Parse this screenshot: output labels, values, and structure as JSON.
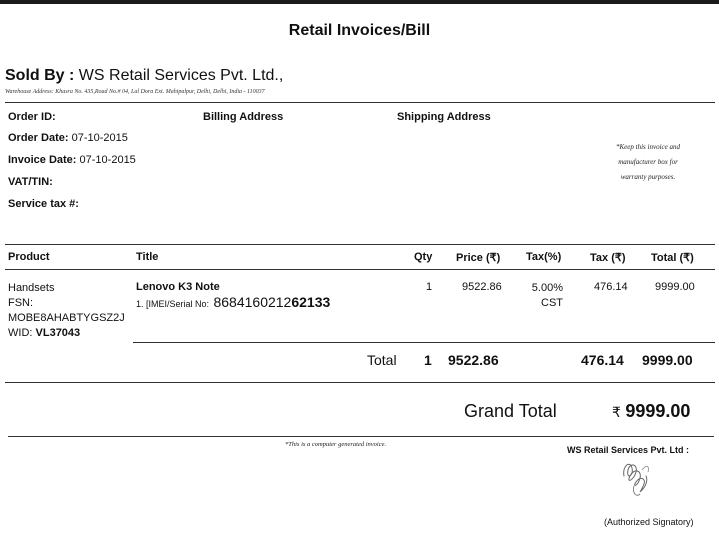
{
  "title": "Retail Invoices/Bill",
  "seller": {
    "sold_by_label": "Sold By :",
    "name": "WS Retail Services Pvt. Ltd.,",
    "warehouse_address": "Warehouse Address: Khasra No. 435,Road No.# 04, Lal Dora Ext. Mahipalpur, Delhi, Delhi, India - 110037"
  },
  "order": {
    "order_id_label": "Order ID:",
    "order_id": "",
    "order_date_label": "Order Date:",
    "order_date": "07-10-2015",
    "invoice_date_label": "Invoice Date:",
    "invoice_date": "07-10-2015",
    "vat_label": "VAT/TIN:",
    "vat": "",
    "service_tax_label": "Service tax #:",
    "service_tax": ""
  },
  "addresses": {
    "billing_label": "Billing Address",
    "shipping_label": "Shipping Address"
  },
  "warranty_note": {
    "line1": "*Keep this invoice and",
    "line2": "manufacturer box for",
    "line3": "warranty purposes."
  },
  "table": {
    "headers": {
      "product": "Product",
      "title": "Title",
      "qty": "Qty",
      "price": "Price (₹)",
      "tax_pct": "Tax(%)",
      "tax": "Tax (₹)",
      "total": "Total (₹)"
    },
    "rows": [
      {
        "product_line1": "Handsets",
        "product_line2": "FSN:",
        "product_line3": "MOBE8AHABTYGSZ2J",
        "wid_label": "WID:",
        "wid": "VL37043",
        "title": "Lenovo K3 Note",
        "imei_label": "1. [IMEI/Serial No:",
        "imei_prefix": "8684160212",
        "imei_suffix": "62133",
        "qty": "1",
        "price": "9522.86",
        "tax_pct": "5.00%",
        "tax_type": "CST",
        "tax": "476.14",
        "total": "9999.00"
      }
    ],
    "totals": {
      "label": "Total",
      "qty": "1",
      "price": "9522.86",
      "tax": "476.14",
      "total": "9999.00"
    }
  },
  "grand_total": {
    "label": "Grand Total",
    "currency": "₹",
    "value": "9999.00"
  },
  "footer": {
    "computer_generated_note": "*This is a computer generated invoice.",
    "signatory_company": "WS Retail Services Pvt. Ltd :",
    "signatory_role": "(Authorized Signatory)"
  }
}
